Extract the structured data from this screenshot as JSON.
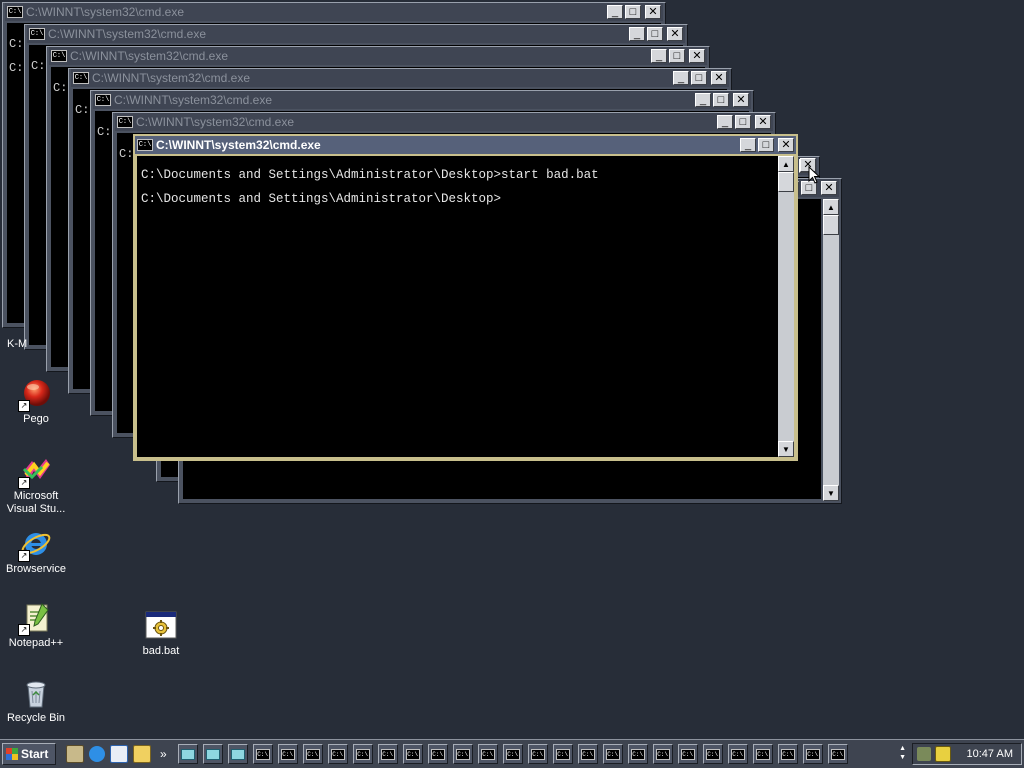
{
  "cmd_windows": [
    {
      "title": "C:\\WINNT\\system32\\cmd.exe",
      "peek": [
        "C:\\",
        "C:\\"
      ]
    },
    {
      "title": "C:\\WINNT\\system32\\cmd.exe",
      "peek": [
        "C:"
      ]
    },
    {
      "title": "C:\\WINNT\\system32\\cmd.exe",
      "peek": [
        "C:"
      ]
    },
    {
      "title": "C:\\WINNT\\system32\\cmd.exe",
      "peek": [
        "C:"
      ]
    },
    {
      "title": "C:\\WINNT\\system32\\cmd.exe",
      "peek": [
        "C:"
      ]
    },
    {
      "title": "C:\\WINNT\\system32\\cmd.exe",
      "peek": [
        "C:"
      ]
    },
    {
      "title": "",
      "peek": []
    }
  ],
  "active_window": {
    "title": "C:\\WINNT\\system32\\cmd.exe",
    "lines": [
      "C:\\Documents and Settings\\Administrator\\Desktop>start bad.bat",
      "C:\\Documents and Settings\\Administrator\\Desktop>"
    ]
  },
  "desktop_icons": [
    {
      "label": "K-M",
      "icon": "app-icon"
    },
    {
      "label": "Pego",
      "icon": "red-ball-icon"
    },
    {
      "label": "Microsoft Visual Stu...",
      "icon": "visual-studio-icon"
    },
    {
      "label": "Browservice",
      "icon": "ie-icon"
    },
    {
      "label": "Notepad++",
      "icon": "notepad-icon"
    },
    {
      "label": "Recycle Bin",
      "icon": "recycle-bin-icon"
    },
    {
      "label": "bad.bat",
      "icon": "batch-file-icon"
    }
  ],
  "taskbar": {
    "start_label": "Start",
    "clock": "10:47 AM",
    "quick_launch": [
      "show-desktop-icon",
      "ie-icon",
      "outlook-icon",
      "search-icon"
    ],
    "notepad_tasks": 3,
    "cmd_tasks": 24
  },
  "tb_glyphs": {
    "minimize": "_",
    "maximize": "□",
    "close": "✕",
    "cmd": "C:\\",
    "up": "▲",
    "down": "▼",
    "chevron": "»",
    "shortcut": "↗"
  },
  "colors": {
    "desktop": "#272d38",
    "active_title": "#56617a",
    "active_border": "#c8bf8c"
  }
}
